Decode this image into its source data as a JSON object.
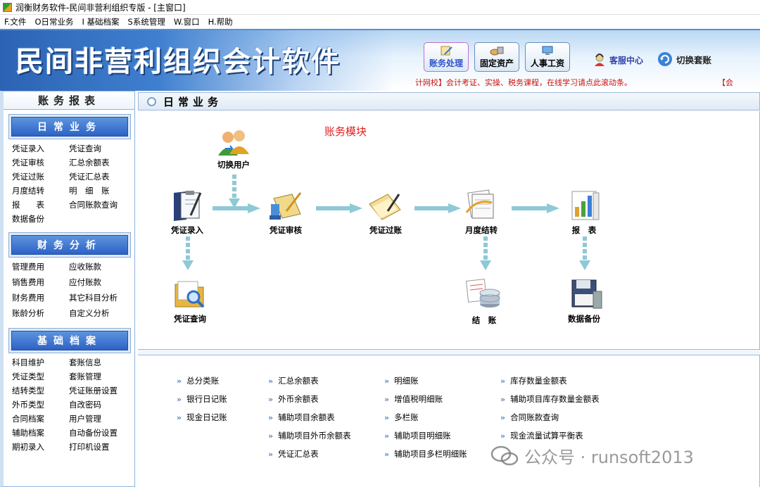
{
  "window": {
    "title": "润衡财务软件-民间非营利组织专版 - [主窗口]"
  },
  "menu": [
    "F.文件",
    "O日常业务",
    "I 基础档案",
    "S系统管理",
    "W.窗口",
    "H.帮助"
  ],
  "banner": {
    "app_title": "民间非营利组织会计软件",
    "buttons": [
      {
        "label": "账务处理",
        "icon": "pen-document-icon"
      },
      {
        "label": "固定资产",
        "icon": "assets-icon"
      },
      {
        "label": "人事工资",
        "icon": "computer-icon"
      }
    ],
    "service": "客服中心",
    "switch_account": "切换套账",
    "ticker": "计网校】会计考证、实操、税务课程，在线学习请点此滚动条。",
    "ticker_end": "【会"
  },
  "sidebar": {
    "title": "账务报表",
    "groups": [
      {
        "title": "日常业务",
        "items": [
          "凭证录入",
          "凭证查询",
          "凭证审核",
          "汇总余额表",
          "凭证过账",
          "凭证汇总表",
          "月度结转",
          "明　细　账",
          "报　　表",
          "合同账款查询",
          "数据备份"
        ]
      },
      {
        "title": "财务分析",
        "items": [
          "管理费用",
          "应收账款",
          "销售费用",
          "应付账款",
          "财务费用",
          "其它科目分析",
          "账龄分析",
          "自定义分析"
        ]
      },
      {
        "title": "基础档案",
        "items": [
          "科目维护",
          "套账信息",
          "凭证类型",
          "套账管理",
          "结转类型",
          "凭证账册设置",
          "外币类型",
          "自改密码",
          "合同档案",
          "用户管理",
          "辅助档案",
          "自动备份设置",
          "期初录入",
          "打印机设置"
        ]
      }
    ]
  },
  "content": {
    "header": "日常业务",
    "flow_title": "账务模块",
    "nodes": {
      "switch_user": "切换用户",
      "entry": "凭证录入",
      "review": "凭证审核",
      "posting": "凭证过账",
      "monthly": "月度结转",
      "report": "报　表",
      "query": "凭证查询",
      "close": "结　账",
      "backup": "数据备份"
    },
    "reports": [
      [
        "总分类账",
        "银行日记账",
        "现金日记账"
      ],
      [
        "汇总余额表",
        "外币余额表",
        "辅助项目余额表",
        "辅助项目外币余额表",
        "凭证汇总表"
      ],
      [
        "明细账",
        "增值税明细账",
        "多栏账",
        "辅助项目明细账",
        "辅助项目多栏明细账"
      ],
      [
        "库存数量金额表",
        "辅助项目库存数量金额表",
        "合同账款查询",
        "现金流量试算平衡表"
      ]
    ]
  },
  "watermark": "公众号 · runsoft2013"
}
